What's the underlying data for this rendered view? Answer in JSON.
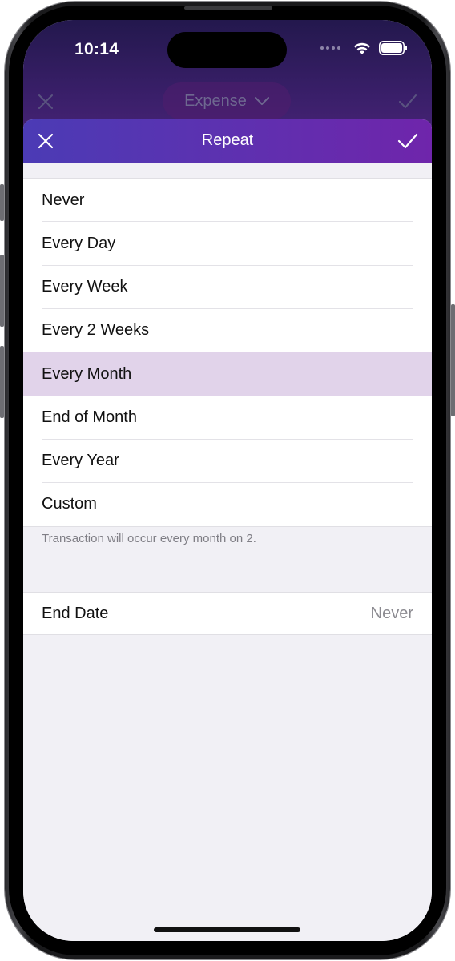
{
  "status_bar": {
    "time": "10:14"
  },
  "background_screen": {
    "title": "Expense"
  },
  "sheet": {
    "title": "Repeat",
    "options": [
      {
        "label": "Never",
        "selected": false
      },
      {
        "label": "Every Day",
        "selected": false
      },
      {
        "label": "Every Week",
        "selected": false
      },
      {
        "label": "Every 2 Weeks",
        "selected": false
      },
      {
        "label": "Every Month",
        "selected": true
      },
      {
        "label": "End of Month",
        "selected": false
      },
      {
        "label": "Every Year",
        "selected": false
      },
      {
        "label": "Custom",
        "selected": false
      }
    ],
    "footnote": "Transaction will occur every month on 2.",
    "end_date": {
      "label": "End Date",
      "value": "Never"
    }
  },
  "icons": {
    "close": "close-icon",
    "confirm": "checkmark-icon",
    "dropdown": "chevron-down-icon",
    "wifi": "wifi-icon",
    "battery": "battery-icon"
  },
  "colors": {
    "accent_gradient_start": "#4b3bb5",
    "accent_gradient_end": "#6f25ab",
    "selected_row": "#e1d3ea",
    "background": "#f1f0f5"
  }
}
